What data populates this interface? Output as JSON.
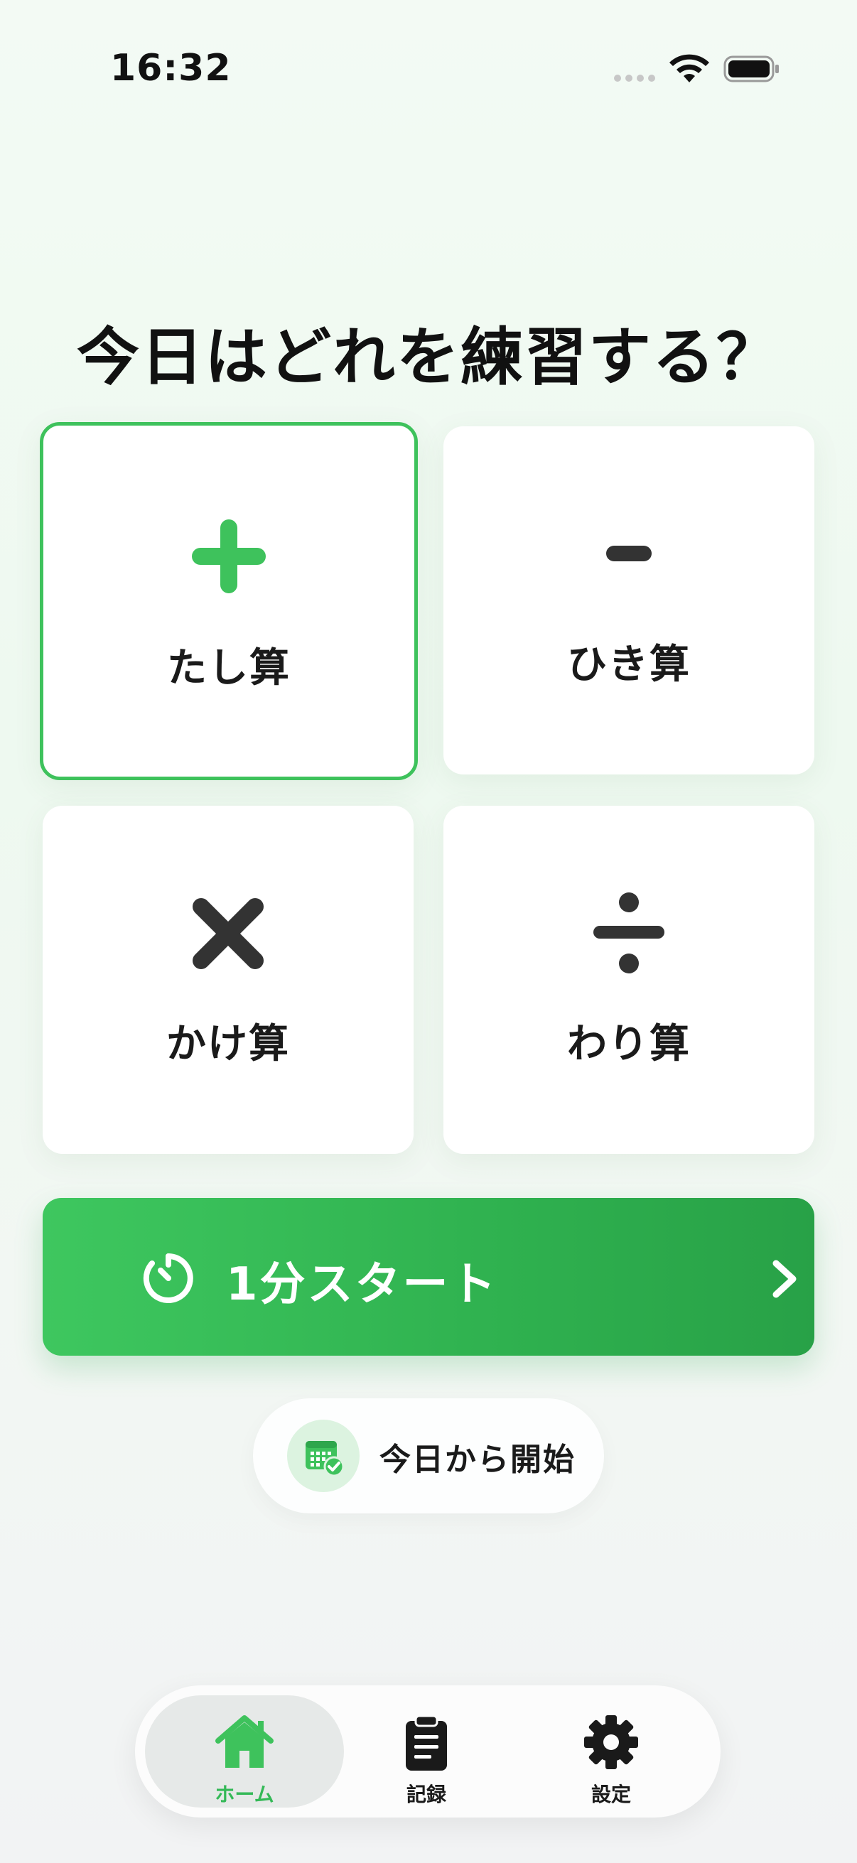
{
  "status_bar": {
    "time": "16:32"
  },
  "headline": "今日はどれを練習する？",
  "operations": [
    {
      "id": "add",
      "symbol": "plus-icon",
      "label": "たし算",
      "selected": true
    },
    {
      "id": "sub",
      "symbol": "minus-icon",
      "label": "ひき算",
      "selected": false
    },
    {
      "id": "mul",
      "symbol": "multiply-icon",
      "label": "かけ算",
      "selected": false
    },
    {
      "id": "div",
      "symbol": "divide-icon",
      "label": "わり算",
      "selected": false
    }
  ],
  "start_button": {
    "label": "1分スタート"
  },
  "today_button": {
    "label": "今日から開始"
  },
  "tabs": [
    {
      "id": "home",
      "label": "ホーム",
      "icon": "home-icon",
      "active": true
    },
    {
      "id": "record",
      "label": "記録",
      "icon": "clipboard-icon",
      "active": false
    },
    {
      "id": "settings",
      "label": "設定",
      "icon": "gear-icon",
      "active": false
    }
  ],
  "colors": {
    "accent": "#3EC25C",
    "accent_dark": "#28A147",
    "icon_dark": "#333333",
    "card_bg": "#FFFFFF"
  }
}
